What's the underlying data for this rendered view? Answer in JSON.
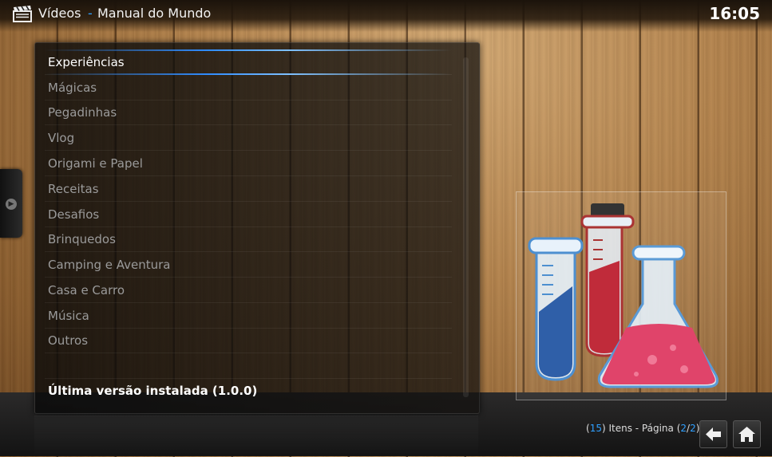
{
  "header": {
    "section_title": "Vídeos",
    "separator": "-",
    "subtitle": "Manual do Mundo",
    "icon": "clapperboard-icon"
  },
  "clock": "16:05",
  "menu": {
    "items": [
      {
        "label": "Experiências",
        "focused": true
      },
      {
        "label": "Mágicas"
      },
      {
        "label": "Pegadinhas"
      },
      {
        "label": "Vlog"
      },
      {
        "label": "Origami e Papel"
      },
      {
        "label": "Receitas"
      },
      {
        "label": "Desafios"
      },
      {
        "label": "Brinquedos"
      },
      {
        "label": "Camping e Aventura"
      },
      {
        "label": "Casa e Carro"
      },
      {
        "label": "Música"
      },
      {
        "label": "Outros"
      }
    ],
    "version_label": "Última versão instalada (1.0.0)"
  },
  "footer": {
    "count": "15",
    "items_text": "Itens - Página",
    "page_current": "2",
    "page_total": "2"
  },
  "icons": {
    "back": "arrow-left-icon",
    "home": "home-icon",
    "side_menu": "play-circle-icon",
    "thumbnail": "laboratory-flasks-icon"
  },
  "colors": {
    "accent": "#2fa0ff",
    "text_active": "#ffffff",
    "text_inactive": "#9a9a9a"
  }
}
